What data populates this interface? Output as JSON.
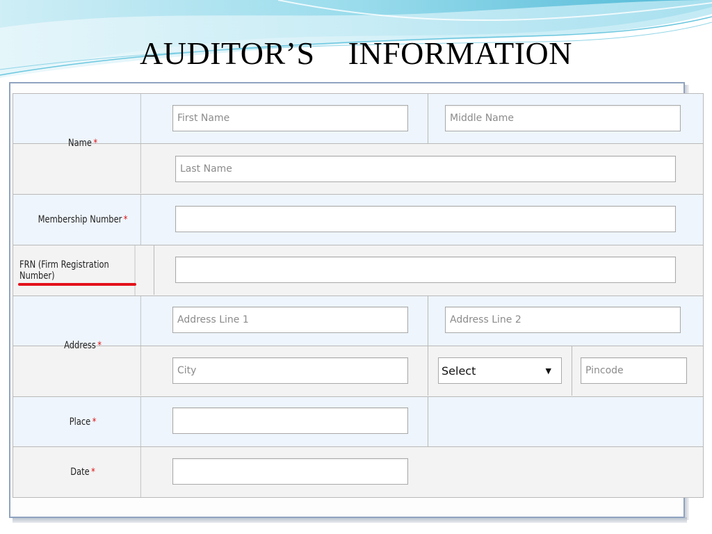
{
  "slide": {
    "title": "AUDITOR’S    INFORMATION"
  },
  "colors": {
    "accent_wave": "#5fc4dc",
    "required_star": "#d11111",
    "underline": "#e2121b",
    "row_blue": "#eef5fc",
    "row_gray": "#f3f3f3"
  },
  "form": {
    "required_marker": "*",
    "name": {
      "label": "Name",
      "first_name_placeholder": "First Name",
      "middle_name_placeholder": "Middle Name",
      "last_name_placeholder": "Last Name"
    },
    "membership": {
      "label": "Membership Number"
    },
    "frn": {
      "label": "FRN (Firm Registration Number)"
    },
    "address": {
      "label": "Address",
      "line1_placeholder": "Address Line 1",
      "line2_placeholder": "Address Line 2",
      "city_placeholder": "City",
      "state_select": "Select",
      "pincode_placeholder": "Pincode",
      "dropdown_icon": "triangle-down-icon"
    },
    "place": {
      "label": "Place"
    },
    "date": {
      "label": "Date"
    }
  }
}
